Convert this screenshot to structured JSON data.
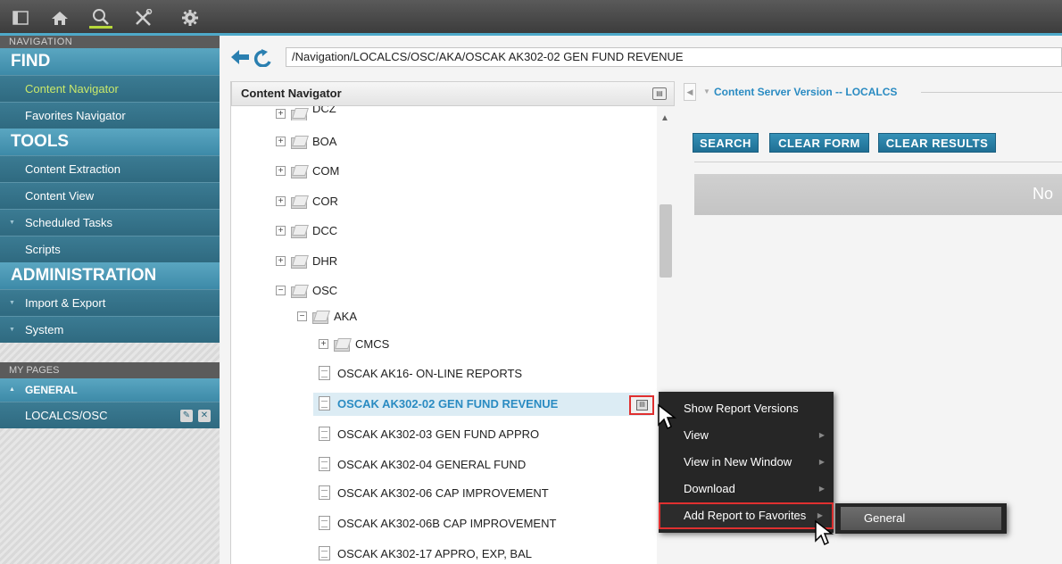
{
  "toolbar": {
    "icons": [
      "panel-toggle-icon",
      "home-icon",
      "search-icon",
      "tools-icon",
      "gear-icon"
    ]
  },
  "sidebar": {
    "navigation_caption": "NAVIGATION",
    "find": {
      "label": "FIND",
      "items": [
        {
          "label": "Content Navigator",
          "selected": true
        },
        {
          "label": "Favorites Navigator"
        }
      ]
    },
    "tools": {
      "label": "TOOLS",
      "items": [
        {
          "label": "Content Extraction"
        },
        {
          "label": "Content View"
        },
        {
          "label": "Scheduled Tasks"
        },
        {
          "label": "Scripts"
        }
      ]
    },
    "administration": {
      "label": "ADMINISTRATION",
      "items": [
        {
          "label": "Import & Export"
        },
        {
          "label": "System"
        }
      ]
    },
    "my_pages": {
      "caption": "MY PAGES",
      "group": "GENERAL",
      "items": [
        {
          "label": "LOCALCS/OSC"
        }
      ]
    }
  },
  "breadcrumb": {
    "path": "/Navigation/LOCALCS/OSC/AKA/OSCAK AK302-02 GEN FUND REVENUE"
  },
  "content_navigator": {
    "title": "Content Navigator",
    "tree": [
      {
        "label": "DCZ"
      },
      {
        "label": "BOA"
      },
      {
        "label": "COM"
      },
      {
        "label": "COR"
      },
      {
        "label": "DCC"
      },
      {
        "label": "DHR"
      },
      {
        "label": "OSC"
      },
      {
        "label": "AKA"
      },
      {
        "label": "CMCS"
      },
      {
        "label": "OSCAK AK16- ON-LINE REPORTS"
      },
      {
        "label": "OSCAK AK302-02 GEN FUND REVENUE"
      },
      {
        "label": "OSCAK AK302-03 GEN FUND APPRO"
      },
      {
        "label": "OSCAK AK302-04 GENERAL FUND"
      },
      {
        "label": "OSCAK AK302-06 CAP IMPROVEMENT"
      },
      {
        "label": "OSCAK AK302-06B CAP IMPROVEMENT"
      },
      {
        "label": "OSCAK AK302-17 APPRO, EXP, BAL"
      }
    ]
  },
  "right_panel": {
    "title": "Content Server Version -- LOCALCS",
    "buttons": {
      "search": "SEARCH",
      "clear_form": "CLEAR FORM",
      "clear_results": "CLEAR RESULTS"
    },
    "results_text": "No"
  },
  "context_menu": {
    "items": [
      {
        "label": "Show Report Versions"
      },
      {
        "label": "View"
      },
      {
        "label": "View in New Window"
      },
      {
        "label": "Download"
      },
      {
        "label": "Add Report to Favorites"
      }
    ],
    "submenu": {
      "items": [
        {
          "label": "General"
        }
      ]
    }
  },
  "colors": {
    "accent_blue": "#3d8aa8",
    "selected_green": "#c9e86a",
    "link_blue": "#2a8bc2",
    "highlight_red": "#e03030"
  }
}
